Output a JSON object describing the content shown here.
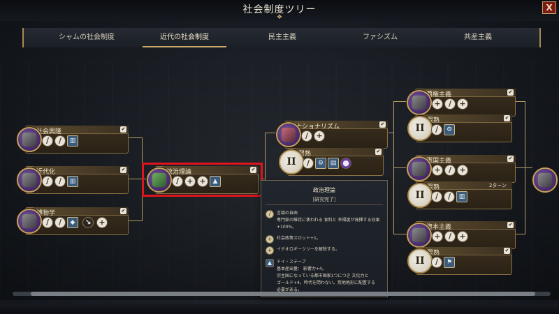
{
  "window": {
    "title": "社会制度ツリー",
    "close_label": "X"
  },
  "tabs": [
    {
      "label": "シャムの社会制度",
      "active": false
    },
    {
      "label": "近代の社会制度",
      "active": true
    },
    {
      "label": "民主主義",
      "active": false
    },
    {
      "label": "ファシズム",
      "active": false
    },
    {
      "label": "共産主義",
      "active": false
    }
  ],
  "nodes": {
    "social_system": {
      "name": "社会興隆",
      "icon": "building-icon",
      "completed": true
    },
    "modernization": {
      "name": "近代化",
      "icon": "crowd-icon",
      "completed": true
    },
    "naturalism": {
      "name": "博物学",
      "icon": "ship-icon",
      "completed": true
    },
    "political_theory": {
      "name": "政治理論",
      "icon": "book-icon",
      "completed": true
    },
    "nationalism": {
      "name": "ナショナリズム",
      "icon": "flag-icon",
      "completed": true
    },
    "mastery_a": {
      "name": "習熟",
      "icon": "roman-two-icon",
      "completed": true
    },
    "hegemony": {
      "name": "覇権主義",
      "icon": "cannon-icon",
      "completed": true
    },
    "mastery_b": {
      "name": "習熟",
      "icon": "roman-two-icon",
      "completed": true
    },
    "militarism": {
      "name": "軍国主義",
      "icon": "rifle-icon",
      "completed": true
    },
    "mastery_c": {
      "name": "習熟",
      "icon": "roman-two-icon",
      "turns": "2ターン"
    },
    "capitalism": {
      "name": "資本主義",
      "icon": "factory-icon",
      "completed": true
    },
    "mastery_d": {
      "name": "習熟",
      "icon": "roman-two-icon",
      "completed": true
    }
  },
  "check_glyph": "✔",
  "roman_two": "II",
  "tooltip": {
    "title": "政治理論",
    "status": "［研究完了］",
    "rows": [
      {
        "icon": "quill-icon",
        "lines": [
          "言論の自由",
          "専門家の維持に使われる 食料と 幸福度が発揮する効果+100%。"
        ]
      },
      {
        "icon": "plus-icon",
        "lines": [
          "社会政策スロット+1。"
        ]
      },
      {
        "icon": "plus-icon",
        "lines": [
          "イデオロギーツリーを解除する。"
        ]
      },
      {
        "icon": "monument-icon",
        "lines": [
          "ドイ・ステープ",
          "基本産出量： 影響力+4。",
          "宗主国になっている都市国家1つにつき 文化力と",
          "ゴールド+4。時代を問わない。荒地地形に配置する",
          "必要がある。"
        ]
      }
    ]
  }
}
